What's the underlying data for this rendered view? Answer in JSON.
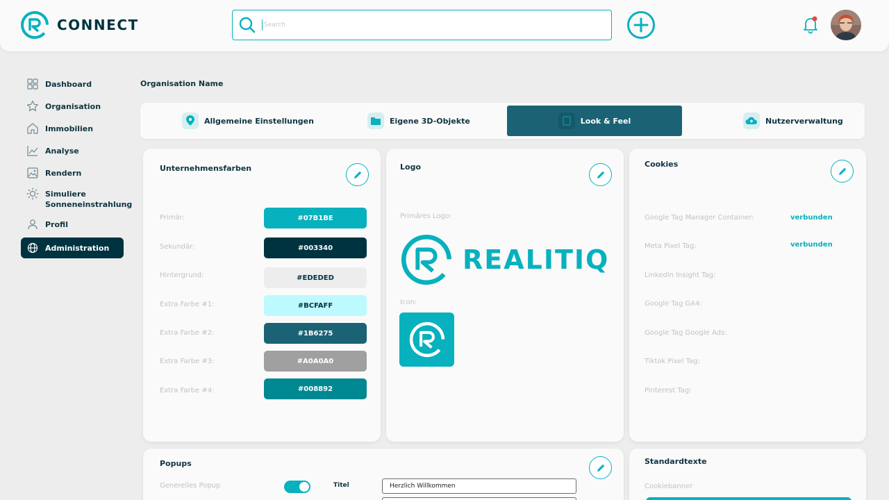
{
  "header": {
    "brand": "CONNECT",
    "search_placeholder": "Search"
  },
  "sidebar": {
    "items": [
      {
        "label": "Dashboard",
        "icon": "grid-icon"
      },
      {
        "label": "Organisation",
        "icon": "star-icon"
      },
      {
        "label": "Immobilien",
        "icon": "house-icon"
      },
      {
        "label": "Analyse",
        "icon": "chart-icon"
      },
      {
        "label": "Rendern",
        "icon": "image-icon"
      },
      {
        "label": "Simuliere Sonneneinstrahlung",
        "icon": "sun-icon"
      },
      {
        "label": "Profil",
        "icon": "user-icon"
      },
      {
        "label": "Administration",
        "icon": "globe-icon",
        "active": true
      }
    ]
  },
  "page": {
    "org_name": "Organisation Name"
  },
  "tabs": [
    {
      "label": "Allgemeine Einstellungen",
      "icon": "location-pin-icon"
    },
    {
      "label": "Eigene 3D-Objekte",
      "icon": "folder-icon"
    },
    {
      "label": "Look & Feel",
      "icon": "document-icon",
      "active": true
    },
    {
      "label": "Nutzerverwaltung",
      "icon": "cloud-icon"
    }
  ],
  "colors_card": {
    "title": "Unternehmensfarben",
    "rows": [
      {
        "label": "Primär:",
        "value": "#07B1BE",
        "bg": "#07B1BE",
        "fg": "#ffffff"
      },
      {
        "label": "Sekundär:",
        "value": "#003340",
        "bg": "#003340",
        "fg": "#ffffff"
      },
      {
        "label": "Hintergrund:",
        "value": "#EDEDED",
        "bg": "#EDEDED",
        "fg": "#003340"
      },
      {
        "label": "Extra Farbe #1:",
        "value": "#BCFAFF",
        "bg": "#BCFAFF",
        "fg": "#003340"
      },
      {
        "label": "Extra Farbe #2:",
        "value": "#1B6275",
        "bg": "#1B6275",
        "fg": "#ffffff"
      },
      {
        "label": "Extra Farbe #3:",
        "value": "#A0A0A0",
        "bg": "#A0A0A0",
        "fg": "#ffffff"
      },
      {
        "label": "Extra Farbe #4:",
        "value": "#008892",
        "bg": "#008892",
        "fg": "#ffffff"
      }
    ]
  },
  "logo_card": {
    "title": "Logo",
    "primary_label": "Primäres Logo:",
    "wordmark": "REALITIQ",
    "icon_label": "Icon:"
  },
  "cookies_card": {
    "title": "Cookies",
    "rows": [
      {
        "label": "Google Tag Manager Container:",
        "value": "verbunden"
      },
      {
        "label": "Meta Pixel Tag:",
        "value": "verbunden"
      },
      {
        "label": "LinkedIn Insight Tag:",
        "value": ""
      },
      {
        "label": "Google Tag GA4:",
        "value": ""
      },
      {
        "label": "Google Tag Google Ads:",
        "value": ""
      },
      {
        "label": "Tiktok Pixel Tag:",
        "value": ""
      },
      {
        "label": "Pinterest Tag:",
        "value": ""
      }
    ]
  },
  "popups_card": {
    "title": "Popups",
    "general_label": "Generelles Popup",
    "title_field_label": "Titel",
    "title_field_value": "Herzlich Willkommen"
  },
  "standardtexte_card": {
    "title": "Standardtexte",
    "cookie_label": "Cookiebanner"
  },
  "theme": {
    "accent": "#07B1BE",
    "dark": "#003340"
  }
}
